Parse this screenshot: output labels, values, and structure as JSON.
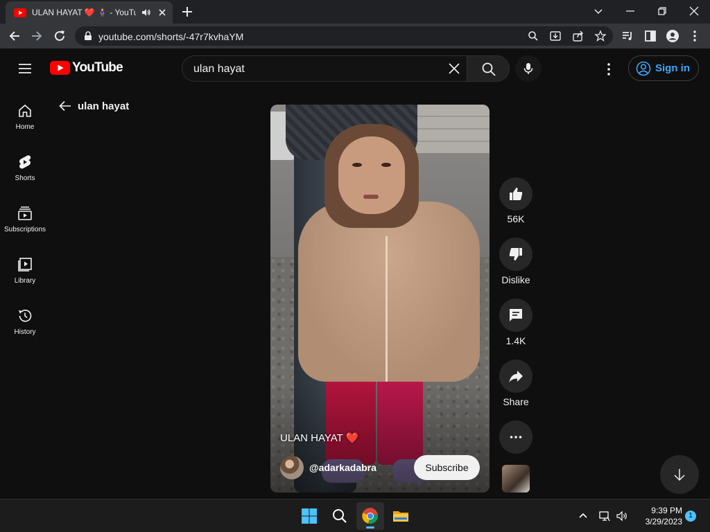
{
  "browser": {
    "tab_title": "ULAN HAYAT ❤️ 🧍‍♀️ - YouTube",
    "url": "youtube.com/shorts/-47r7kvhaYM"
  },
  "youtube": {
    "logo_text": "YouTube",
    "search_query": "ulan hayat",
    "sign_in_label": "Sign in",
    "guide": [
      {
        "label": "Home",
        "icon": "home-icon"
      },
      {
        "label": "Shorts",
        "icon": "shorts-icon"
      },
      {
        "label": "Subscriptions",
        "icon": "subscriptions-icon"
      },
      {
        "label": "Library",
        "icon": "library-icon"
      },
      {
        "label": "History",
        "icon": "history-icon"
      }
    ],
    "back_label": "ulan hayat",
    "short": {
      "title": "ULAN HAYAT",
      "title_emoji": "❤️",
      "channel": "@adarkadabra",
      "subscribe_label": "Subscribe"
    },
    "actions": {
      "likes": "56K",
      "dislike_label": "Dislike",
      "comments": "1.4K",
      "share_label": "Share"
    }
  },
  "taskbar": {
    "time": "9:39 PM",
    "date": "3/29/2023",
    "notification_count": "1"
  },
  "colors": {
    "youtube_red": "#ff0000",
    "link_blue": "#3ea6ff",
    "accent": "#4cc2ff"
  }
}
